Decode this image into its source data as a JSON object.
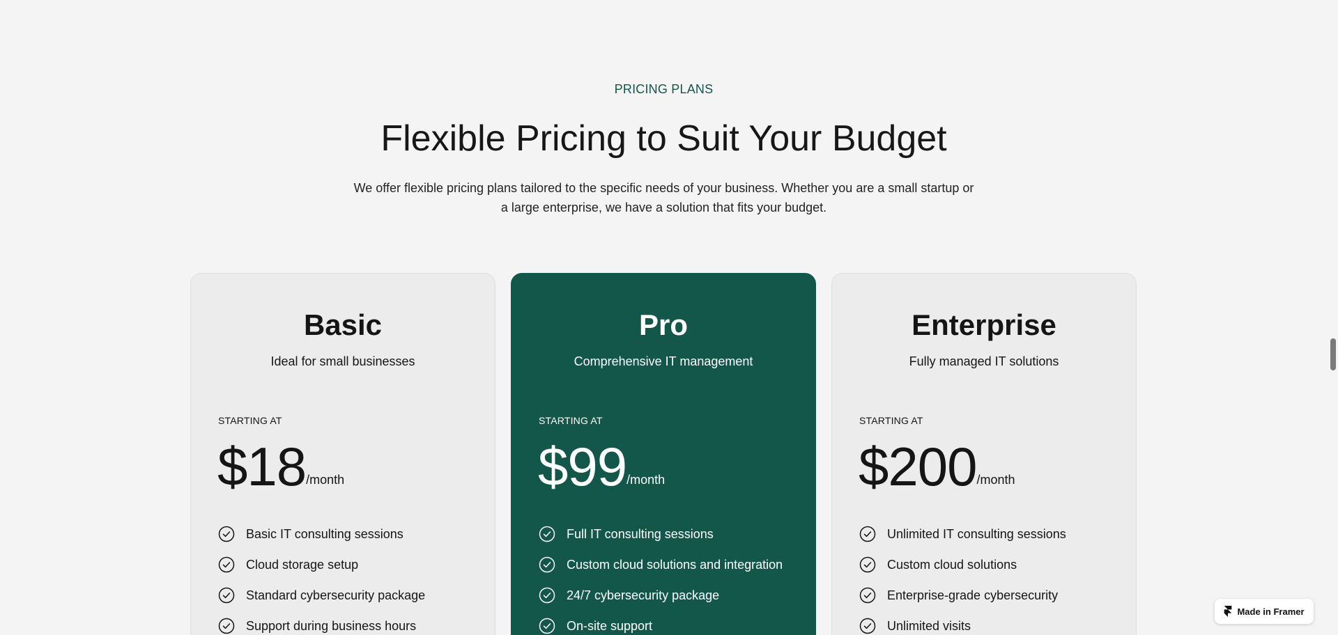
{
  "section": {
    "eyebrow": "PRICING PLANS",
    "title": "Flexible Pricing to Suit Your Budget",
    "description": "We offer flexible pricing plans tailored to the specific needs of your business. Whether you are a small startup or a large enterprise, we have a solution that fits your budget."
  },
  "colors": {
    "accent": "#13574a",
    "background": "#f4f4f4",
    "card": "#ececec"
  },
  "plans": [
    {
      "name": "Basic",
      "tagline": "Ideal for small businesses",
      "starting_label": "STARTING AT",
      "price": "$18",
      "period": "/month",
      "features": [
        "Basic IT consulting sessions",
        "Cloud storage setup",
        "Standard cybersecurity package",
        "Support during business hours"
      ]
    },
    {
      "name": "Pro",
      "tagline": "Comprehensive IT management",
      "starting_label": "STARTING AT",
      "price": "$99",
      "period": "/month",
      "features": [
        "Full IT consulting sessions",
        "Custom cloud solutions and integration",
        "24/7 cybersecurity package",
        "On-site support"
      ]
    },
    {
      "name": "Enterprise",
      "tagline": "Fully managed IT solutions",
      "starting_label": "STARTING AT",
      "price": "$200",
      "period": "/month",
      "features": [
        "Unlimited IT consulting sessions",
        "Custom cloud solutions",
        "Enterprise-grade cybersecurity",
        "Unlimited visits"
      ]
    }
  ],
  "badge": {
    "label": "Made in Framer",
    "icon": "framer-logo-icon"
  }
}
